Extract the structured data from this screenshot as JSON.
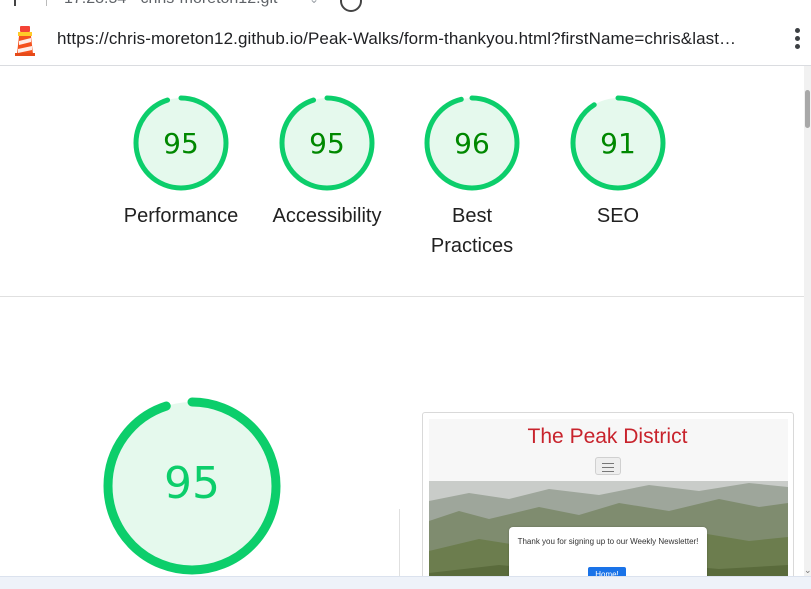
{
  "tab": {
    "title": "17:28:54 - chris-moreton12.git",
    "chevron": "⌄"
  },
  "address_bar": {
    "url": "https://chris-moreton12.github.io/Peak-Walks/form-thankyou.html?firstName=chris&last…",
    "site_icon": "lighthouse-icon",
    "menu_icon": "kebab-menu-icon"
  },
  "colors": {
    "pass_green": "#0cce6b",
    "pass_fill": "#e5f9ed",
    "score_text": "#008800",
    "big_score_text": "#0cce6b"
  },
  "scores": [
    {
      "value": "95",
      "label": "Performance",
      "fraction": 0.95
    },
    {
      "value": "95",
      "label": "Accessibility",
      "fraction": 0.95
    },
    {
      "value": "96",
      "label": "Best Practices",
      "fraction": 0.96
    },
    {
      "value": "91",
      "label": "SEO",
      "fraction": 0.91
    }
  ],
  "summary": {
    "value": "95",
    "fraction": 0.95
  },
  "preview": {
    "site_title": "The Peak District",
    "message": "Thank you for signing up to our Weekly Newsletter!",
    "button_label": "Home!"
  }
}
